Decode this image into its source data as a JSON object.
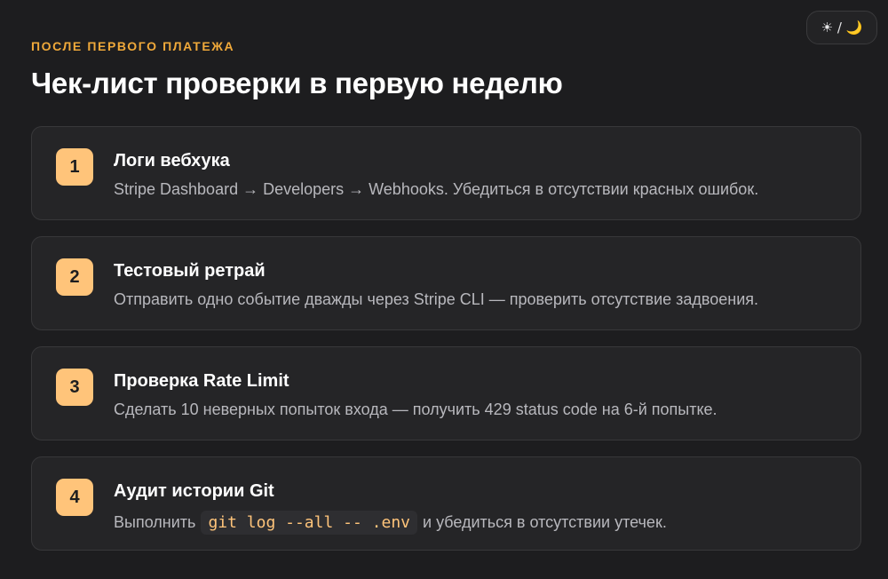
{
  "theme_toggle": {
    "label": "☀︎ / 🌙"
  },
  "header": {
    "eyebrow": "ПОСЛЕ ПЕРВОГО ПЛАТЕЖА",
    "title": "Чек-лист проверки в первую неделю"
  },
  "colors": {
    "accent": "#ffc47a",
    "eyebrow": "#f0a93a",
    "background": "#1d1d1f",
    "card": "#252527"
  },
  "items": [
    {
      "number": "1",
      "title": "Логи вебхука",
      "description": "Stripe Dashboard → Developers → Webhooks. Убедиться в отсутствии красных ошибок."
    },
    {
      "number": "2",
      "title": "Тестовый ретрай",
      "description": "Отправить одно событие дважды через Stripe CLI — проверить отсутствие задвоения."
    },
    {
      "number": "3",
      "title": "Проверка Rate Limit",
      "description": "Сделать 10 неверных попыток входа — получить 429 status code на 6-й попытке."
    },
    {
      "number": "4",
      "title": "Аудит истории Git",
      "description_before": "Выполнить",
      "code": "git log --all -- .env",
      "description_after": "и убедиться в отсутствии утечек."
    }
  ]
}
